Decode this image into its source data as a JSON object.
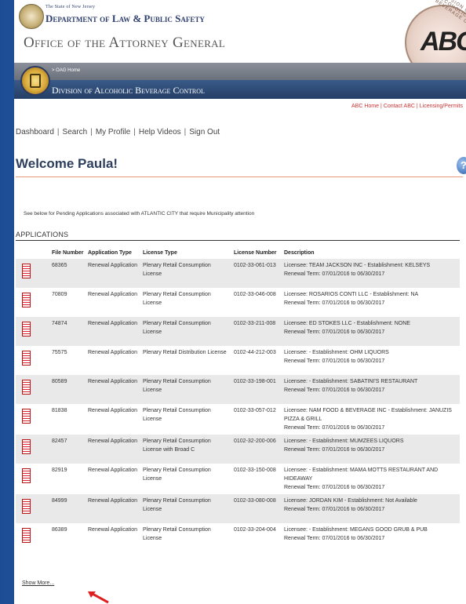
{
  "header": {
    "state": "The State of New Jersey",
    "department": "Department of Law & Public Safety",
    "office": "Office of the Attorney General",
    "seal_text": "ABC",
    "seal_ring_text": "DIVISION OF ALCOHOLIC BEVERAGE CONTROL",
    "breadcrumb": "> OAG Home",
    "division": "Division of Alcoholic Beverage Control"
  },
  "top_links": [
    "ABC Home",
    "Contact ABC",
    "Licensing/Permits"
  ],
  "nav": [
    "Dashboard",
    "Search",
    "My Profile",
    "Help Videos",
    "Sign Out"
  ],
  "welcome": "Welcome Paula!",
  "help_icon": "?",
  "intro": "See below for Pending Applications associated with ATLANTIC CITY that require Municipality attention",
  "applications_heading": "APPLICATIONS",
  "table": {
    "columns": [
      "File Number",
      "Application Type",
      "License Type",
      "License Number",
      "Description"
    ],
    "rows": [
      {
        "file": "68365",
        "app_type": "Renewal Application",
        "license_type": "Plenary Retail Consumption License",
        "license_number": "0102-33-061-013",
        "desc1": "Licensee: TEAM JACKSON INC - Establishment: KELSEYS",
        "desc2": "Renewal Term: 07/01/2016 to 06/30/2017"
      },
      {
        "file": "70809",
        "app_type": "Renewal Application",
        "license_type": "Plenary Retail Consumption License",
        "license_number": "0102-33-046-008",
        "desc1": "Licensee: ROSARIOS CONTI LLC - Establishment: NA",
        "desc2": "Renewal Term: 07/01/2016 to 06/30/2017"
      },
      {
        "file": "74874",
        "app_type": "Renewal Application",
        "license_type": "Plenary Retail Consumption License",
        "license_number": "0102-33-211-008",
        "desc1": "Licensee: ED STOKES LLC - Establishment: NONE",
        "desc2": "Renewal Term: 07/01/2016 to 06/30/2017"
      },
      {
        "file": "75575",
        "app_type": "Renewal Application",
        "license_type": "Plenary Retail Distribution License",
        "license_number": "0102-44-212-003",
        "desc1": "Licensee: - Establishment: OHM LIQUORS",
        "desc2": "Renewal Term: 07/01/2016 to 06/30/2017"
      },
      {
        "file": "80589",
        "app_type": "Renewal Application",
        "license_type": "Plenary Retail Consumption License",
        "license_number": "0102-33-198-001",
        "desc1": "Licensee: - Establishment: SABATINI'S RESTAURANT",
        "desc2": "Renewal Term: 07/01/2016 to 06/30/2017"
      },
      {
        "file": "81838",
        "app_type": "Renewal Application",
        "license_type": "Plenary Retail Consumption License",
        "license_number": "0102-33-057-012",
        "desc1": "Licensee: NAM FOOD & BEVERAGE INC - Establishment: JANUZIS PIZZA & GRILL",
        "desc2": "Renewal Term: 07/01/2016 to 06/30/2017"
      },
      {
        "file": "82457",
        "app_type": "Renewal Application",
        "license_type": "Plenary Retail Consumption License with Broad C",
        "license_number": "0102-32-200-006",
        "desc1": "Licensee: - Establishment: MUMZEES LIQUORS",
        "desc2": "Renewal Term: 07/01/2016 to 06/30/2017"
      },
      {
        "file": "82919",
        "app_type": "Renewal Application",
        "license_type": "Plenary Retail Consumption License",
        "license_number": "0102-33-150-008",
        "desc1": "Licensee: - Establishment: MAMA MOTTS RESTAURANT AND HIDEAWAY",
        "desc2": "Renewal Term: 07/01/2016 to 06/30/2017"
      },
      {
        "file": "84999",
        "app_type": "Renewal Application",
        "license_type": "Plenary Retail Consumption License",
        "license_number": "0102-33-080-008",
        "desc1": "Licensee: JORDAN KIM - Establishment: Not Available",
        "desc2": "Renewal Term: 07/01/2016 to 06/30/2017"
      },
      {
        "file": "86389",
        "app_type": "Renewal Application",
        "license_type": "Plenary Retail Consumption License",
        "license_number": "0102-33-204-004",
        "desc1": "Licensee: - Establishment: MEGANS GOOD GRUB & PUB",
        "desc2": "Renewal Term: 07/01/2016 to 06/30/2017"
      }
    ]
  },
  "show_more": "Show More...",
  "colors": {
    "background_blue": "#2b5a9a",
    "band_gray": "#7a808b",
    "band_blue": "#2f4c77",
    "link_red": "#cc3333",
    "title_navy": "#2e3f5e",
    "row_stripe": "#e9e9e9",
    "arrow_red": "#e02020"
  },
  "icons": {
    "row_document": "pdf-document-icon",
    "help": "help-icon",
    "annotation": "red-arrow-icon"
  }
}
